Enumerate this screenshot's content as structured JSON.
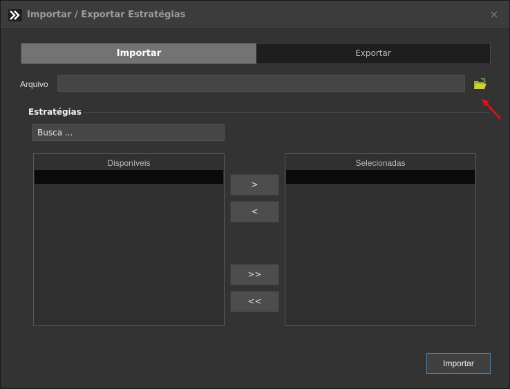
{
  "window": {
    "title": "Importar / Exportar Estratégias",
    "close_glyph": "×"
  },
  "tabs": [
    {
      "label": "Importar",
      "active": true
    },
    {
      "label": "Exportar",
      "active": false
    }
  ],
  "file": {
    "label": "Arquivo",
    "value": "",
    "browse_icon": "folder-open-icon"
  },
  "strategies": {
    "group_label": "Estratégias",
    "search_placeholder": "Busca ..."
  },
  "lists": {
    "available": {
      "header": "Disponíveis"
    },
    "selected": {
      "header": "Selecionadas"
    }
  },
  "transfer_buttons": {
    "add_one": ">",
    "remove_one": "<",
    "add_all": ">>",
    "remove_all": "<<"
  },
  "footer": {
    "primary_label": "Importar"
  },
  "colors": {
    "accent_border": "#4f7fa8",
    "active_tab": "#737373",
    "annotation_arrow": "#e01010",
    "folder_icon": "#c9d13b"
  }
}
